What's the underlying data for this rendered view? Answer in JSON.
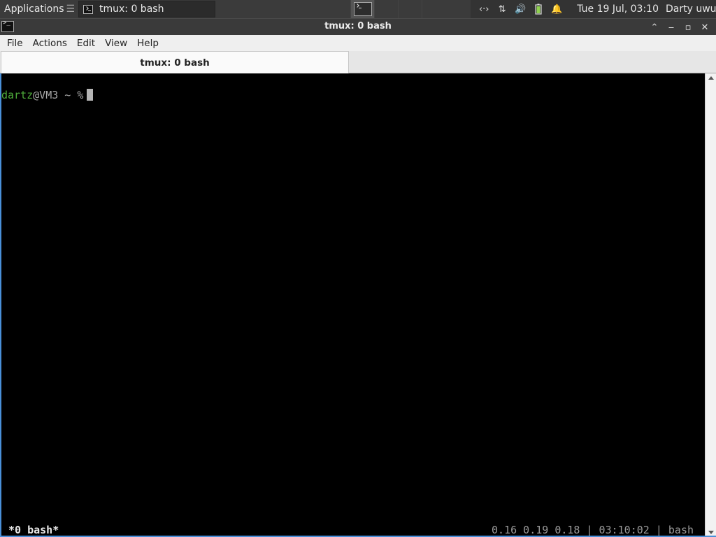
{
  "panel": {
    "applications_label": "Applications",
    "task_title": "tmux: 0 bash",
    "clock": "Tue 19 Jul, 03:10",
    "user": "Darty uwu",
    "tray_icons": [
      "network-icon",
      "transfer-icon",
      "volume-icon",
      "battery-icon",
      "notification-bell-icon"
    ]
  },
  "window": {
    "title": "tmux: 0 bash",
    "menu": [
      "File",
      "Actions",
      "Edit",
      "View",
      "Help"
    ],
    "tab_title": "tmux: 0 bash"
  },
  "terminal": {
    "prompt_user": "dartz",
    "prompt_rest": "@VM3 ~ %",
    "status_left": "*0 bash*",
    "status_right": "0.16 0.19 0.18 | 03:10:02 | bash"
  },
  "colors": {
    "prompt_user": "#4dab3a",
    "accent": "#4a90d9",
    "terminal_bg": "#000000"
  }
}
